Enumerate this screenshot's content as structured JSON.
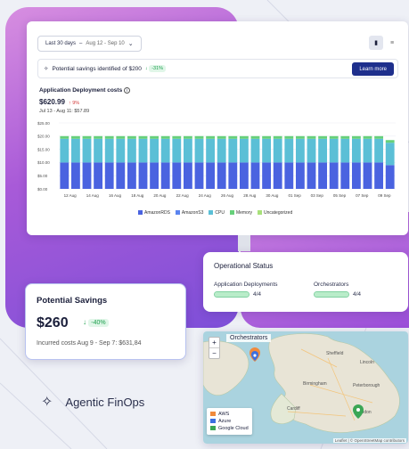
{
  "dashboard": {
    "date_range": "Last 30 days",
    "date_range_detail": "Aug 12 - Sep 10",
    "savings_banner": "Potential savings identified of $200",
    "savings_delta": "-31%",
    "learn_more": "Learn more",
    "deploy_title": "Application Deployment costs",
    "cost": "$620.99",
    "cost_delta": "9%",
    "previous": "Jul 13 - Aug 11: $57.89"
  },
  "chart_data": {
    "type": "bar",
    "stacked": true,
    "ylim": [
      0,
      25
    ],
    "y_ticks": [
      "$25.00",
      "$20.00",
      "$15.00",
      "$10.00",
      "$5.00",
      "$0.00"
    ],
    "x_tick_labels": [
      "12 Aug",
      "14 Aug",
      "16 Aug",
      "18 Aug",
      "20 Aug",
      "22 Aug",
      "24 Aug",
      "26 Aug",
      "28 Aug",
      "30 Aug",
      "01 Sep",
      "03 Sep",
      "05 Sep",
      "07 Sep",
      "09 Sep"
    ],
    "num_bars": 30,
    "series": [
      {
        "name": "AmazonRDS",
        "color": "#4a63e0",
        "values": [
          10,
          10,
          10,
          10,
          10,
          10,
          10,
          10,
          10,
          10,
          10,
          10,
          10,
          10,
          10,
          10,
          10,
          10,
          10,
          10,
          10,
          10,
          10,
          10,
          10,
          10,
          10,
          10,
          10,
          9
        ]
      },
      {
        "name": "AmazonS3",
        "color": "#5b84f0",
        "values": [
          0,
          0,
          0,
          0,
          0,
          0,
          0,
          0,
          0,
          0,
          0,
          0,
          0,
          0,
          0,
          0,
          0,
          0,
          0,
          0,
          0,
          0,
          0,
          0,
          0,
          0,
          0,
          0,
          0,
          0
        ]
      },
      {
        "name": "CPU",
        "color": "#5bbfd6",
        "values": [
          9,
          9,
          9,
          9,
          9,
          9,
          9,
          9,
          9,
          9,
          9,
          9,
          9,
          9,
          9,
          9,
          9,
          9,
          9,
          9,
          9,
          9,
          9,
          9,
          9,
          9,
          9,
          9,
          9,
          8.5
        ]
      },
      {
        "name": "Memory",
        "color": "#66d07a",
        "values": [
          1,
          1,
          1,
          1,
          1,
          1,
          1,
          1,
          1,
          1,
          1,
          1,
          1,
          1,
          1,
          1,
          1,
          1,
          1,
          1,
          1,
          1,
          1,
          1,
          1,
          1,
          1,
          1,
          1,
          1
        ]
      },
      {
        "name": "Uncategorized",
        "color": "#a8e07a",
        "values": [
          0,
          0,
          0,
          0,
          0,
          0,
          0,
          0,
          0,
          0,
          0,
          0,
          0,
          0,
          0,
          0,
          0,
          0,
          0,
          0,
          0,
          0,
          0,
          0,
          0,
          0,
          0,
          0,
          0,
          0
        ]
      }
    ]
  },
  "operational_status": {
    "title": "Operational Status",
    "items": [
      {
        "label": "Application Deployments",
        "value": "4/4",
        "fraction": 1.0
      },
      {
        "label": "Orchestrators",
        "value": "4/4",
        "fraction": 1.0
      }
    ]
  },
  "potential_savings": {
    "title": "Potential Savings",
    "amount": "$260",
    "delta": "-40%",
    "incurred": "Incurred costs Aug 9 - Sep 7: $631,84"
  },
  "map": {
    "title": "Orchestrators",
    "zoom_in": "+",
    "zoom_out": "−",
    "legend": [
      {
        "name": "AWS",
        "color": "#f08a3c"
      },
      {
        "name": "Azure",
        "color": "#3b6fe0"
      },
      {
        "name": "Google Cloud",
        "color": "#3aa655"
      }
    ],
    "attribution": "Leaflet | © OpenStreetMap contributors",
    "places": [
      "Sheffield",
      "Lincoln",
      "Birmingham",
      "Peterborough",
      "Cardiff",
      "London"
    ]
  },
  "brand": {
    "name": "Agentic FinOps"
  }
}
